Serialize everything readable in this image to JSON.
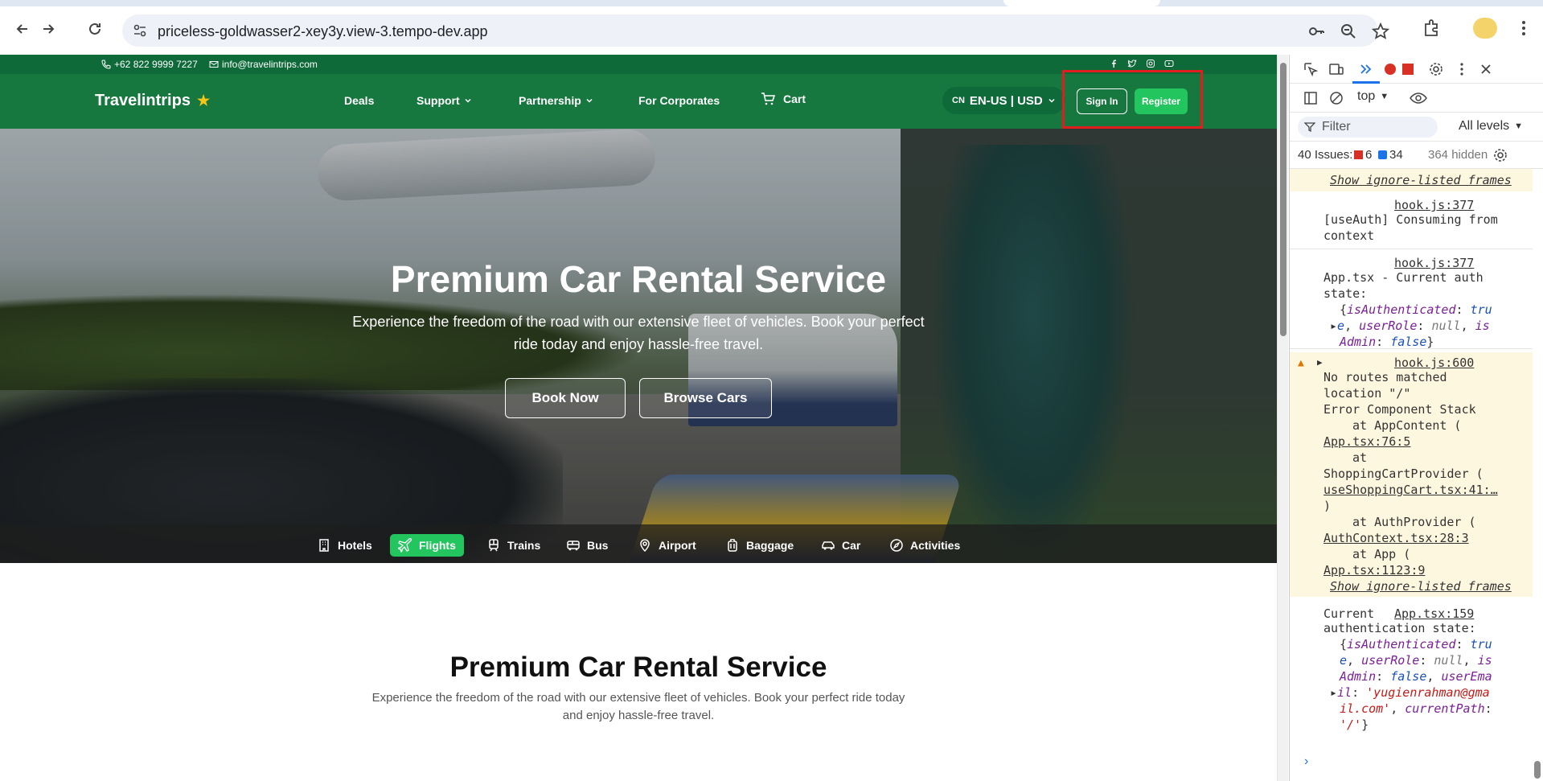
{
  "browser": {
    "url": "priceless-goldwasser2-xey3y.view-3.tempo-dev.app"
  },
  "topbar": {
    "phone": "+62 822 9999 7227",
    "email": "info@travelintrips.com",
    "social_icons": [
      "facebook-icon",
      "twitter-icon",
      "instagram-icon",
      "youtube-icon"
    ]
  },
  "nav": {
    "logo": "Travelintrips",
    "links": [
      {
        "label": "Deals",
        "has_dropdown": false
      },
      {
        "label": "Support",
        "has_dropdown": true
      },
      {
        "label": "Partnership",
        "has_dropdown": true
      },
      {
        "label": "For Corporates",
        "has_dropdown": false
      },
      {
        "label": "Cart",
        "has_dropdown": false,
        "icon": "cart-icon"
      }
    ],
    "lang_flag": "CN",
    "lang_label": "EN-US | USD",
    "signin_label": "Sign In",
    "register_label": "Register"
  },
  "hero": {
    "title": "Premium Car Rental Service",
    "subtitle": "Experience the freedom of the road with our extensive fleet of vehicles. Book your perfect ride today and enjoy hassle-free travel.",
    "book_now": "Book Now",
    "browse_cars": "Browse Cars"
  },
  "categories": [
    {
      "label": "Hotels",
      "icon": "hotel-icon",
      "active": false
    },
    {
      "label": "Flights",
      "icon": "plane-icon",
      "active": true
    },
    {
      "label": "Trains",
      "icon": "train-icon",
      "active": false
    },
    {
      "label": "Bus",
      "icon": "bus-icon",
      "active": false
    },
    {
      "label": "Airport",
      "icon": "map-pin-icon",
      "active": false
    },
    {
      "label": "Baggage",
      "icon": "luggage-icon",
      "active": false
    },
    {
      "label": "Car",
      "icon": "car-icon",
      "active": false
    },
    {
      "label": "Activities",
      "icon": "compass-icon",
      "active": false
    }
  ],
  "section": {
    "title": "Premium Car Rental Service",
    "subtitle": "Experience the freedom of the road with our extensive fleet of vehicles. Book your perfect ride today and enjoy hassle-free travel."
  },
  "devtools": {
    "context": "top",
    "filter_placeholder": "Filter",
    "levels": "All levels",
    "issues_label": "40 Issues:",
    "issues_errors": "6",
    "issues_info": "34",
    "hidden_count": "364 hidden",
    "messages": {
      "ignore_frames": "Show ignore-listed frames",
      "hook377a": "hook.js:377",
      "useauth_1": "[useAuth] Consuming from",
      "useauth_2": "context",
      "hook377b": "hook.js:377",
      "apptsx_1": "App.tsx - Current auth",
      "apptsx_2": "state:",
      "hook600": "hook.js:600",
      "warn_1": "No routes matched",
      "warn_2": "location \"/\"",
      "warn_3": "Error Component Stack",
      "warn_4": "at AppContent (",
      "warn_5": "App.tsx:76:5",
      "warn_6": "at",
      "warn_7": "ShoppingCartProvider (",
      "warn_8": "useShoppingCart.tsx:41:…",
      "warn_9": ")",
      "warn_10": "at AuthProvider (",
      "warn_11": "AuthContext.tsx:28:3",
      "warn_12": "at App (",
      "warn_13": "App.tsx:1123:9",
      "app159": "App.tsx:159",
      "current_1": "Current",
      "current_2": "authentication state:"
    }
  },
  "colors": {
    "topbar": "#0f6a3a",
    "nav": "#17783f",
    "accent": "#22c55e",
    "highlight": "#e11d1d"
  }
}
